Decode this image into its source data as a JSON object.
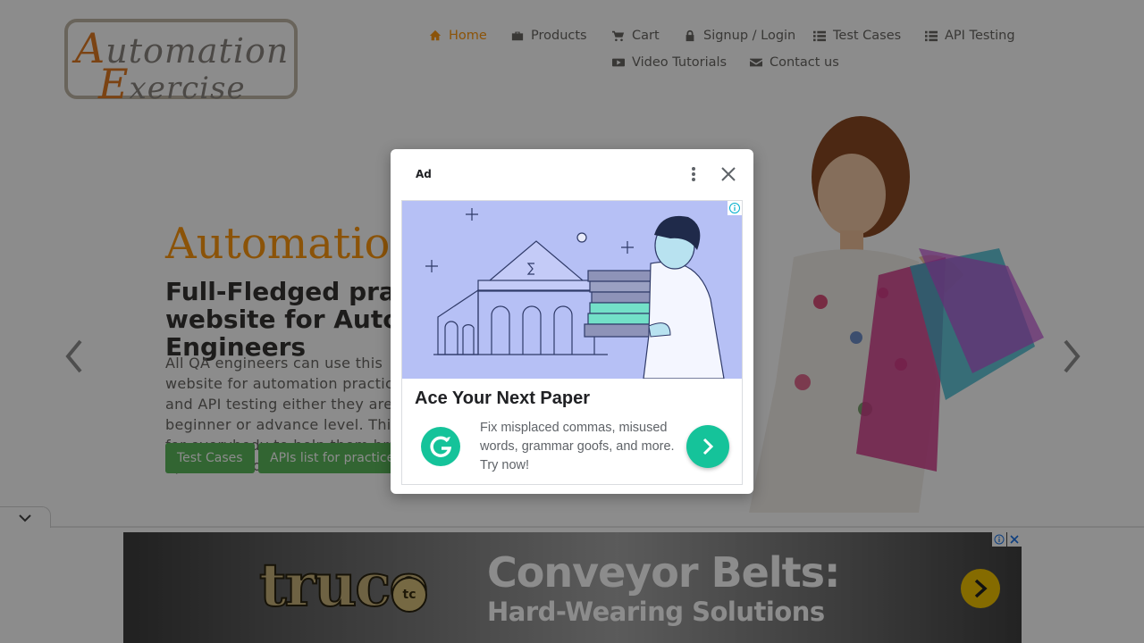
{
  "header": {
    "logo": {
      "line1": "Automation",
      "line2": "Exercise"
    },
    "nav": [
      {
        "label": "Home",
        "icon": "home-icon",
        "active": true
      },
      {
        "label": "Products",
        "icon": "briefcase-icon",
        "active": false
      },
      {
        "label": "Cart",
        "icon": "cart-icon",
        "active": false
      },
      {
        "label": "Signup / Login",
        "icon": "lock-icon",
        "active": false
      },
      {
        "label": "Test Cases",
        "icon": "list-icon",
        "active": false
      },
      {
        "label": "API Testing",
        "icon": "list-icon",
        "active": false
      },
      {
        "label": "Video Tutorials",
        "icon": "youtube-icon",
        "active": false
      },
      {
        "label": "Contact us",
        "icon": "envelope-icon",
        "active": false
      }
    ]
  },
  "slider": {
    "heading": "AutomationExercise",
    "subheading": "Full-Fledged practice website for Automation Engineers",
    "text": "All QA engineers can use this website for automation practice and API testing either they are at beginner or advance level. This is for everybody to help them brush up their automation skills.",
    "buttons": {
      "test_cases": "Test Cases",
      "apis": "APIs list for practice"
    }
  },
  "modal": {
    "ad_label": "Ad",
    "title": "Ace Your Next Paper",
    "body": "Fix misplaced commas, misused words, grammar goofs, and more. Try now!"
  },
  "banner": {
    "brand": "truco",
    "badge": "tc",
    "title": "Conveyor Belts:",
    "subtitle": "Hard-Wearing Solutions"
  },
  "colors": {
    "accent": "#fe980f",
    "button_green": "#5cb85c",
    "grammarly_green": "#15c39a"
  }
}
